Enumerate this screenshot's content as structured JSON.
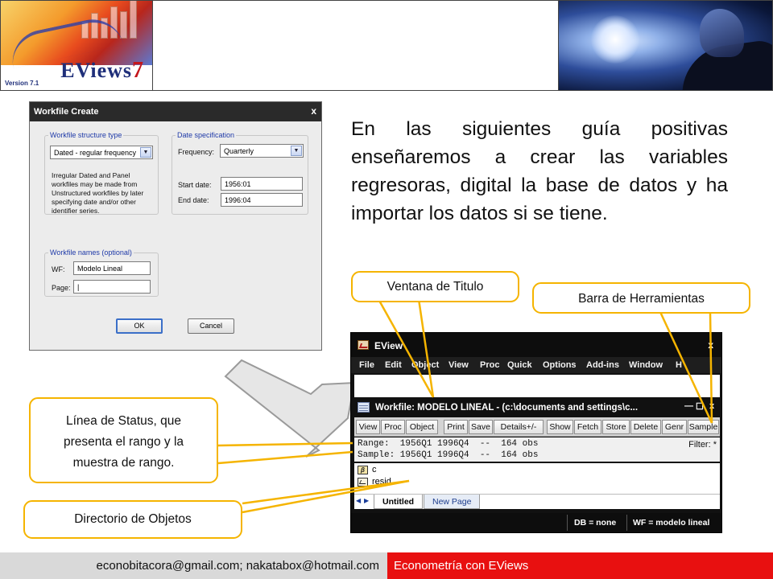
{
  "header": {
    "logo": {
      "product": "EViews",
      "version_number": "7",
      "version_label": "Version 7.1"
    }
  },
  "dialog": {
    "title": "Workfile Create",
    "close": "x",
    "structure_group": "Workfile structure type",
    "structure_value": "Dated - regular frequency",
    "structure_note": [
      "Irregular Dated and Panel",
      "workfiles may be made from",
      "Unstructured workfiles by later",
      "specifying date and/or other",
      "identifier series."
    ],
    "date_group": "Date specification",
    "frequency_label": "Frequency:",
    "frequency_value": "Quarterly",
    "start_label": "Start date:",
    "start_value": "1956:01",
    "end_label": "End date:",
    "end_value": "1996:04",
    "names_group": "Workfile names (optional)",
    "wf_label": "WF:",
    "wf_value": "Modelo Lineal",
    "page_label": "Page:",
    "page_value": "|",
    "ok": "OK",
    "cancel": "Cancel"
  },
  "description": "En las siguientes guía positivas enseñaremos a crear las variables regresoras, digital la base de datos y ha importar los datos si se tiene.",
  "eviews": {
    "title": "EView",
    "close": "x",
    "menu": [
      "File",
      "Edit",
      "Object",
      "View",
      "Proc",
      "Quick",
      "Options",
      "Add-ins",
      "Window",
      "H"
    ],
    "workfile_title": "Workfile: MODELO LINEAL - (c:\\documents and settings\\c...",
    "workfile_controls": [
      "—",
      "☐",
      "x"
    ],
    "toolbar": [
      "View",
      "Proc",
      "Object",
      "Print",
      "Save",
      "Details+/-",
      "Show",
      "Fetch",
      "Store",
      "Delete",
      "Genr",
      "Sample"
    ],
    "range_line": "Range:  1956Q1 1996Q4  --  164 obs",
    "sample_line": "Sample: 1956Q1 1996Q4  --  164 obs",
    "filter": "Filter: *",
    "objects": [
      {
        "name": "c",
        "icon": "coefficient-icon",
        "glyph": "β"
      },
      {
        "name": "resid",
        "icon": "series-icon",
        "glyph": ""
      }
    ],
    "tabs": [
      "Untitled",
      "New Page"
    ],
    "status": {
      "db": "DB = none",
      "wf": "WF = modelo lineal"
    }
  },
  "callouts": {
    "title_window": "Ventana de Titulo",
    "toolbar": "Barra de Herramientas",
    "status_line": "Línea de Status, que presenta el rango  y la muestra de rango.",
    "objects_dir": "Directorio de Objetos"
  },
  "footer": {
    "emails": "econobitacora@gmail.com;  nakatabox@hotmail.com",
    "course": "Econometría con EViews"
  },
  "colors": {
    "callout_border": "#f5b400",
    "footer_red": "#e81010",
    "footer_gray": "#d9d9d9"
  }
}
